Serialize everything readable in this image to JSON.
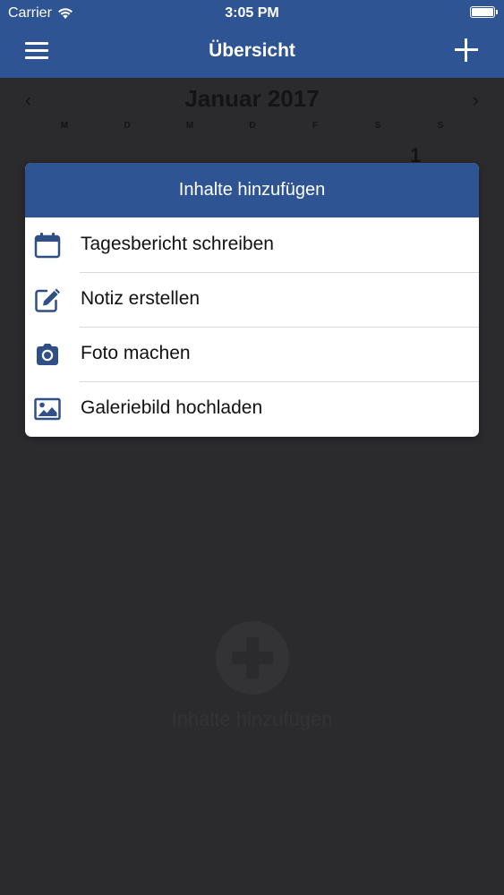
{
  "status_bar": {
    "carrier": "Carrier",
    "time": "3:05 PM"
  },
  "nav": {
    "title": "Übersicht",
    "menu_icon": "hamburger-menu-icon",
    "add_icon": "plus-icon"
  },
  "calendar": {
    "month": "Januar 2017",
    "prev_icon": "chevron-left-icon",
    "next_icon": "chevron-right-icon",
    "weekdays": [
      "M",
      "D",
      "M",
      "D",
      "F",
      "S",
      "S"
    ],
    "first_day": "1"
  },
  "empty_state": {
    "icon": "plus-circle-icon",
    "text": "Inhalte hinzufügen"
  },
  "modal": {
    "title": "Inhalte hinzufügen",
    "items": [
      {
        "label": "Tagesbericht schreiben",
        "icon": "calendar-icon"
      },
      {
        "label": "Notiz erstellen",
        "icon": "edit-note-icon"
      },
      {
        "label": "Foto machen",
        "icon": "camera-icon"
      },
      {
        "label": "Galeriebild hochladen",
        "icon": "image-gallery-icon"
      }
    ]
  },
  "colors": {
    "brand_blue": "#2f5493",
    "overlay_bg": "#2b2b2d",
    "icon_blue": "#2f4f86"
  }
}
